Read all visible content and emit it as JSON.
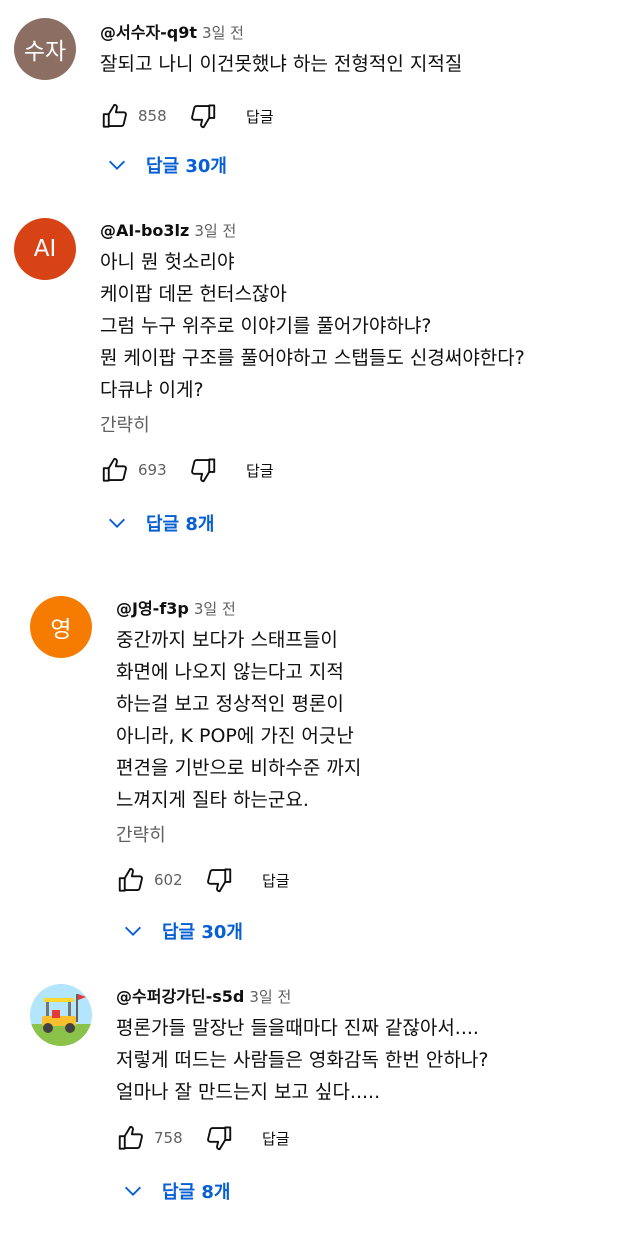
{
  "comments": [
    {
      "avatar_text": "수자",
      "avatar_color": "#8d6e63",
      "author": "@서수자-q9t",
      "time": "3일 전",
      "lines": [
        "잘되고 나니 이건못했냐 하는 전형적인 지적질"
      ],
      "read_less": "",
      "likes": "858",
      "reply_label": "답글",
      "replies_label": "답글 30개"
    },
    {
      "avatar_text": "AI",
      "avatar_color": "#d84315",
      "author": "@AI-bo3lz",
      "time": "3일 전",
      "lines": [
        "아니 뭔 헛소리야",
        "케이팝 데몬 헌터스잖아",
        "그럼 누구 위주로 이야기를 풀어가야하냐?",
        "뭔 케이팝 구조를 풀어야하고 스탭들도 신경써야한다?",
        "다큐냐 이게?"
      ],
      "read_less": "간략히",
      "likes": "693",
      "reply_label": "답글",
      "replies_label": "답글 8개"
    },
    {
      "avatar_text": "영",
      "avatar_color": "#f57c00",
      "author": "@J영-f3p",
      "time": "3일 전",
      "lines": [
        "중간까지 보다가  스태프들이",
        "화면에 나오지 않는다고 지적",
        "하는걸 보고 정상적인 평론이",
        "아니라, K POP에 가진 어긋난",
        "편견을 기반으로 비하수준 까지",
        "느껴지게 질타 하는군요."
      ],
      "read_less": "간략히",
      "likes": "602",
      "reply_label": "답글",
      "replies_label": "답글 30개"
    },
    {
      "avatar_text": "",
      "avatar_color": "#b3e5fc",
      "avatar_icon": "golf-cart-icon",
      "author": "@수퍼강가딘-s5d",
      "time": "3일 전",
      "lines": [
        "평론가들 말장난 들을때마다 진짜 같잖아서....",
        "저렇게 떠드는 사람들은 영화감독 한번 안하나?",
        "얼마나 잘 만드는지 보고 싶다....."
      ],
      "read_less": "",
      "likes": "758",
      "reply_label": "답글",
      "replies_label": "답글 8개"
    }
  ]
}
